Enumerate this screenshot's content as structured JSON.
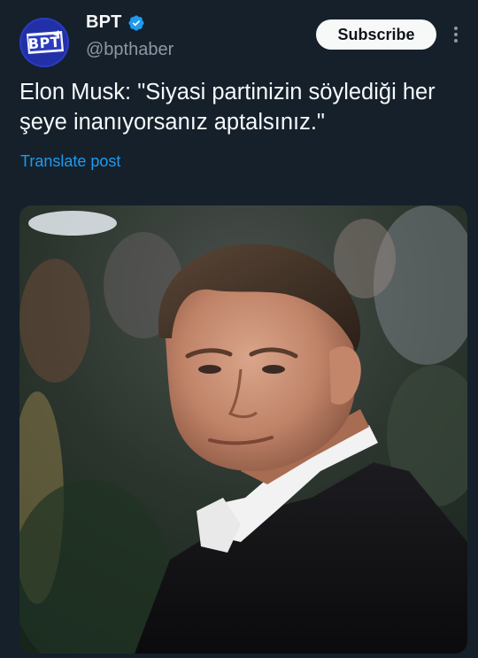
{
  "post": {
    "author": {
      "display_name": "BPT",
      "handle": "@bpthaber",
      "avatar_text": "BPT",
      "verified_icon": "verified-badge-icon",
      "verified_color": "#1d9bf0"
    },
    "subscribe_label": "Subscribe",
    "more_icon": "more-vertical-icon",
    "text": "Elon Musk: \"Siyasi partinizin söylediği her şeye inanıyorsanız aptalsınız.\"",
    "translate_label": "Translate post",
    "media": {
      "kind": "photo"
    }
  },
  "colors": {
    "background": "#15202b",
    "text_primary": "#f7f9f9",
    "text_secondary": "#8b98a5",
    "link": "#1d9bf0",
    "button_bg": "#f7f9f9",
    "avatar_bg": "#2a3bbd"
  }
}
